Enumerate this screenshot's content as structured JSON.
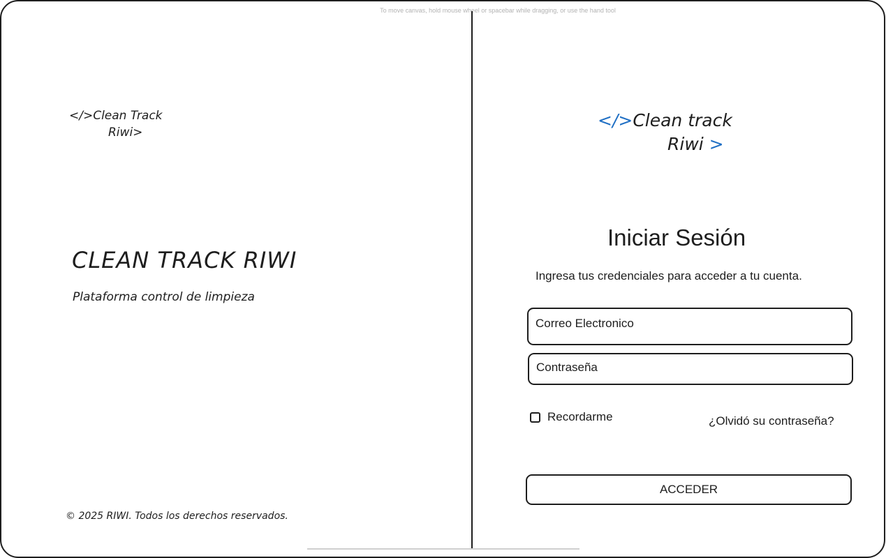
{
  "canvas_hint": "To move canvas, hold mouse wheel or spacebar while dragging, or use the hand tool",
  "left": {
    "logo_line1": "</>Clean Track",
    "logo_line2": "Riwi>",
    "brand_title": "CLEAN TRACK RIWI",
    "brand_subtitle": "Plataforma control de limpieza",
    "copyright": "© 2025 RIWI. Todos los derechos reservados."
  },
  "right": {
    "logo_tag": "</>",
    "logo_line1": "Clean track",
    "logo_line2": "Riwi",
    "logo_chevron": ">",
    "title": "Iniciar Sesión",
    "subtitle": "Ingresa tus credenciales para acceder a tu cuenta.",
    "email_placeholder": "Correo Electronico",
    "password_placeholder": "Contraseña",
    "remember_label": "Recordarme",
    "forgot_label": "¿Olvidó su contraseña?",
    "submit_label": "ACCEDER"
  },
  "colors": {
    "accent": "#1f6fc4",
    "ink": "#1e1e1e",
    "hint": "#b3b3b3"
  }
}
